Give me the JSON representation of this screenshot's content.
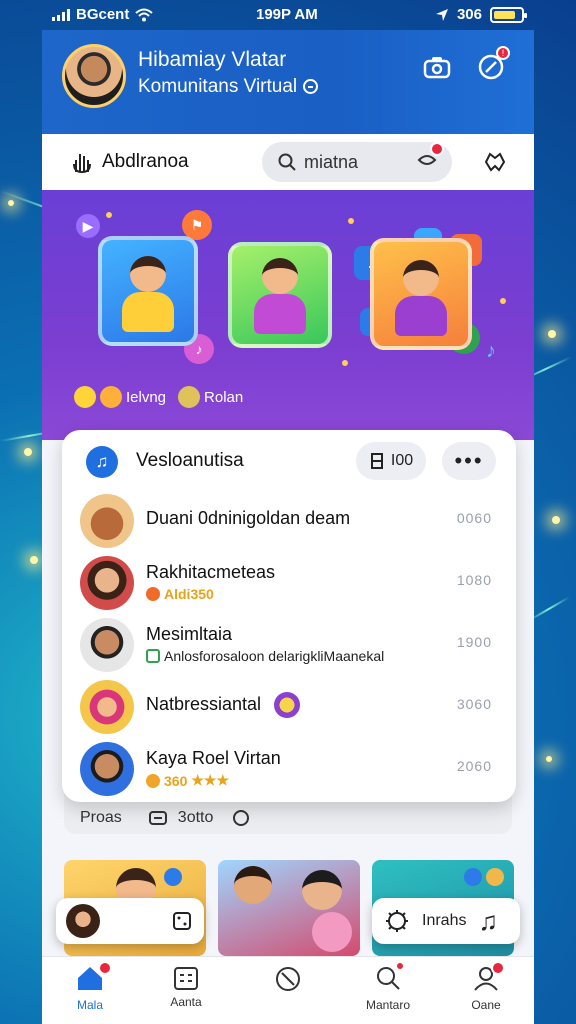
{
  "statusbar": {
    "carrier": "BGcent",
    "time": "199P AM",
    "battery_text": "306"
  },
  "header": {
    "title": "Hibamiay Vlatar",
    "subtitle": "Komunitans Virtual"
  },
  "searchrow": {
    "left_label": "Abdlranoa",
    "search_value": "miatna"
  },
  "banner": {
    "tags": [
      "Ielvng",
      "Rolan"
    ]
  },
  "card": {
    "title": "Vesloanutisa",
    "pill_label": "I00",
    "rows": [
      {
        "name": "Duani 0dninigoldan deam",
        "sub": "",
        "value": "0060"
      },
      {
        "name": "Rakhitacmeteas",
        "sub": "Aldi350",
        "value": "1080"
      },
      {
        "name": "Mesimltaia",
        "sub": "Anlosforosaloon delarigkliMaanekal",
        "value": "1900"
      },
      {
        "name": "Natbressiantal",
        "sub": "",
        "value": "3060"
      },
      {
        "name": "Kaya Roel Virtan",
        "sub": "360",
        "value": "2060"
      }
    ]
  },
  "strip": {
    "left": "Proas",
    "right": "3otto"
  },
  "pill_right": {
    "label": "Inrahs"
  },
  "tabs": [
    {
      "label": "Mala",
      "icon": "home-icon",
      "active": true
    },
    {
      "label": "Aanta",
      "icon": "calendar-icon",
      "active": false
    },
    {
      "label": "",
      "icon": "explore-icon",
      "active": false
    },
    {
      "label": "Mantaro",
      "icon": "search-chat-icon",
      "active": false
    },
    {
      "label": "Oane",
      "icon": "profile-icon",
      "active": false
    }
  ],
  "colors": {
    "primary": "#1f6fe0",
    "header": "#1e66c9",
    "banner": "#6a3fd6",
    "badge": "#e8263d",
    "gold": "#e9a21a"
  }
}
